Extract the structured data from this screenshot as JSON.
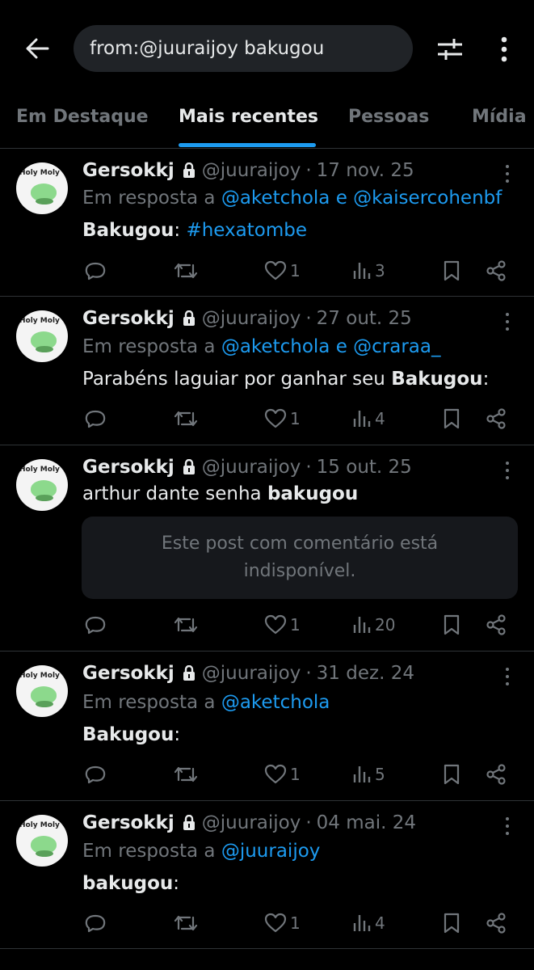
{
  "search": {
    "query": "from:@juuraijoy bakugou"
  },
  "tabs": [
    {
      "label": "Em Destaque"
    },
    {
      "label": "Mais recentes"
    },
    {
      "label": "Pessoas"
    },
    {
      "label": "Mídia"
    }
  ],
  "avatar_text": "Holy Moly",
  "posts": [
    {
      "name": "Gersokkj",
      "handle": "@juuraijoy",
      "sep": "·",
      "date": "17 nov. 25",
      "reply_prefix": "Em resposta a",
      "reply_to_1": "@aketchola",
      "reply_join": "e",
      "reply_to_2": "@kaisercohenbf",
      "text_bold": "Bakugou",
      "text_colon": ":",
      "hashtag": "#hexatombe",
      "likes": "1",
      "views": "3"
    },
    {
      "name": "Gersokkj",
      "handle": "@juuraijoy",
      "sep": "·",
      "date": "27 out. 25",
      "reply_prefix": "Em resposta a",
      "reply_to_1": "@aketchola",
      "reply_join": "e",
      "reply_to_2": "@craraa_",
      "text_plain": "Parabéns laguiar por ganhar seu ",
      "text_bold": "Bakugou",
      "text_colon": ":",
      "likes": "1",
      "views": "4"
    },
    {
      "name": "Gersokkj",
      "handle": "@juuraijoy",
      "sep": "·",
      "date": "15 out. 25",
      "text_plain": "arthur dante senha ",
      "text_bold": "bakugou",
      "quote_unavailable": "Este post com comentário está indisponível.",
      "likes": "1",
      "views": "20"
    },
    {
      "name": "Gersokkj",
      "handle": "@juuraijoy",
      "sep": "·",
      "date": "31 dez. 24",
      "reply_prefix": "Em resposta a",
      "reply_to_1": "@aketchola",
      "text_bold": "Bakugou",
      "text_colon": ":",
      "likes": "1",
      "views": "5"
    },
    {
      "name": "Gersokkj",
      "handle": "@juuraijoy",
      "sep": "·",
      "date": "04 mai. 24",
      "reply_prefix": "Em resposta a",
      "reply_to_1": "@juuraijoy",
      "text_bold": "bakugou",
      "text_colon": ":",
      "likes": "1",
      "views": "4"
    }
  ],
  "icons": {
    "back": "arrow-left-icon",
    "filter": "sliders-icon",
    "more": "more-vertical-icon",
    "lock": "lock-icon",
    "reply": "comment-icon",
    "repost": "repost-icon",
    "like": "heart-icon",
    "views": "views-chart-icon",
    "bookmark": "bookmark-icon",
    "share": "share-icon"
  },
  "colors": {
    "background": "#000000",
    "accent": "#1d9bf0",
    "text": "#e7e9ea",
    "muted": "#71767b",
    "search_bg": "#202327"
  }
}
